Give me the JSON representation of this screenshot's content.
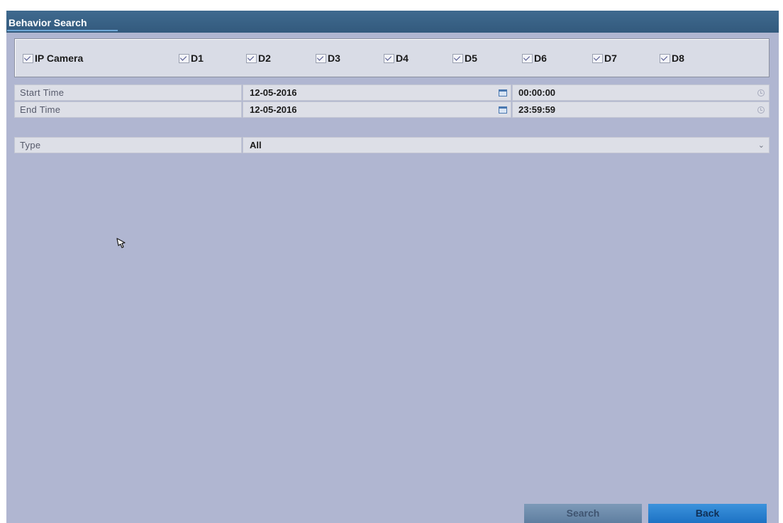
{
  "window": {
    "title": "Behavior Search"
  },
  "cameras": {
    "group_label": "IP Camera",
    "channels": [
      "D1",
      "D2",
      "D3",
      "D4",
      "D5",
      "D6",
      "D7",
      "D8"
    ]
  },
  "start_time": {
    "label": "Start Time",
    "date": "12-05-2016",
    "time": "00:00:00"
  },
  "end_time": {
    "label": "End Time",
    "date": "12-05-2016",
    "time": "23:59:59"
  },
  "type": {
    "label": "Type",
    "value": "All"
  },
  "buttons": {
    "search": "Search",
    "back": "Back"
  },
  "colors": {
    "accent": "#1d72c4",
    "title_bar": "#3f6a8f",
    "background": "#b0b6d1"
  }
}
